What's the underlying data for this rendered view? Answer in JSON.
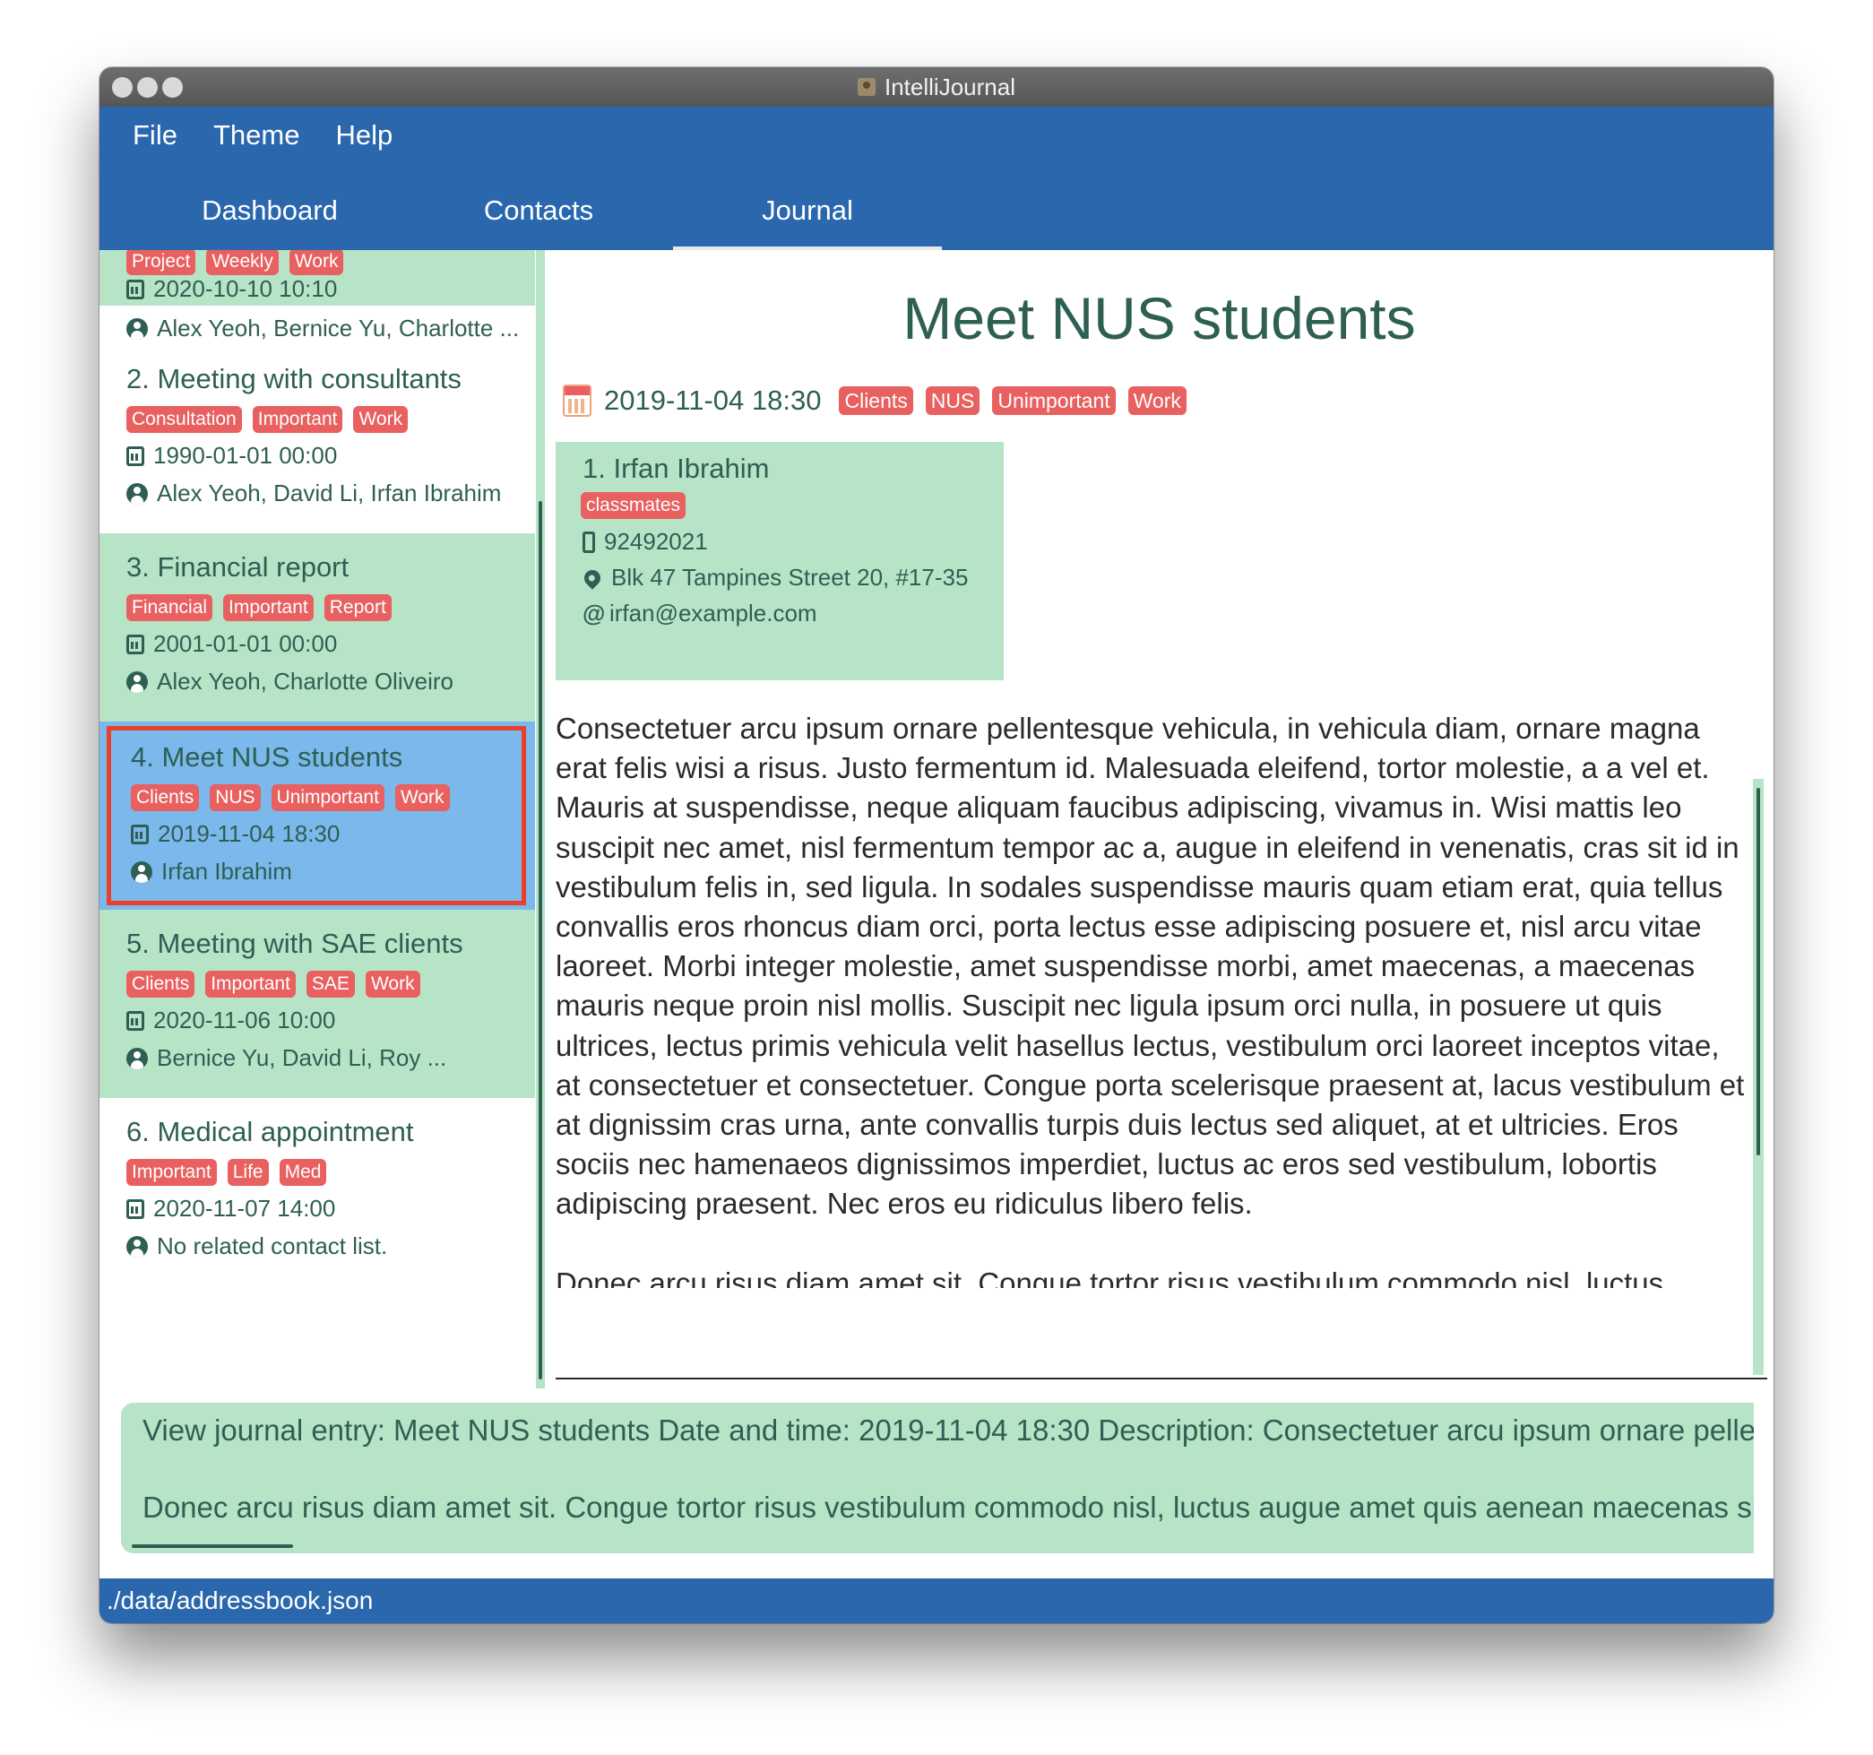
{
  "window": {
    "title": "IntelliJournal"
  },
  "menu": [
    "File",
    "Theme",
    "Help"
  ],
  "tabs": [
    "Dashboard",
    "Contacts",
    "Journal"
  ],
  "entries": [
    {
      "title": "",
      "tags": [
        "Project",
        "Weekly",
        "Work"
      ],
      "datetime": "2020-10-10 10:10",
      "contacts": "Alex Yeoh, Bernice Yu, Charlotte ..."
    },
    {
      "title": "2.  Meeting with consultants",
      "tags": [
        "Consultation",
        "Important",
        "Work"
      ],
      "datetime": "1990-01-01 00:00",
      "contacts": "Alex Yeoh, David Li, Irfan Ibrahim"
    },
    {
      "title": "3.  Financial report",
      "tags": [
        "Financial",
        "Important",
        "Report"
      ],
      "datetime": "2001-01-01 00:00",
      "contacts": "Alex Yeoh, Charlotte Oliveiro"
    },
    {
      "title": "4.  Meet NUS students",
      "tags": [
        "Clients",
        "NUS",
        "Unimportant",
        "Work"
      ],
      "datetime": "2019-11-04 18:30",
      "contacts": "Irfan Ibrahim"
    },
    {
      "title": "5.  Meeting with SAE clients",
      "tags": [
        "Clients",
        "Important",
        "SAE",
        "Work"
      ],
      "datetime": "2020-11-06 10:00",
      "contacts": "Bernice Yu, David Li, Roy ..."
    },
    {
      "title": "6.  Medical appointment",
      "tags": [
        "Important",
        "Life",
        "Med"
      ],
      "datetime": "2020-11-07 14:00",
      "contacts": "No related contact list."
    }
  ],
  "detail": {
    "title": "Meet NUS students",
    "datetime": "2019-11-04 18:30",
    "tags": [
      "Clients",
      "NUS",
      "Unimportant",
      "Work"
    ],
    "contact": {
      "name": "1.  Irfan Ibrahim",
      "tag": "classmates",
      "phone": "92492021",
      "address": "Blk 47 Tampines Street 20, #17-35",
      "email": "irfan@example.com"
    },
    "description": [
      "Consectetuer arcu ipsum ornare pellentesque vehicula, in vehicula diam, ornare magna erat felis wisi a risus. Justo fermentum id. Malesuada eleifend, tortor molestie, a a vel et. Mauris at suspendisse, neque aliquam faucibus adipiscing, vivamus in. Wisi mattis leo suscipit nec amet, nisl fermentum tempor ac a, augue in eleifend in venenatis, cras sit id in vestibulum felis in, sed ligula. In sodales suspendisse mauris quam etiam erat, quia tellus convallis eros rhoncus diam orci, porta lectus esse adipiscing posuere et, nisl arcu vitae laoreet. Morbi integer molestie, amet suspendisse morbi, amet maecenas, a maecenas mauris neque proin nisl mollis. Suscipit nec ligula ipsum orci nulla, in posuere ut quis ultrices, lectus primis vehicula velit hasellus lectus, vestibulum orci laoreet inceptos vitae, at consectetuer et consectetuer. Congue porta scelerisque praesent at, lacus vestibulum et at dignissim cras urna, ante convallis turpis duis lectus sed aliquet, at et ultricies. Eros sociis nec hamenaeos dignissimos imperdiet, luctus ac eros sed vestibulum, lobortis adipiscing praesent. Nec eros eu ridiculus libero felis.",
      "Donec arcu risus diam amet sit. Congue tortor risus vestibulum commodo nisl, luctus augue"
    ]
  },
  "result": {
    "line1": "View journal entry: Meet NUS students Date and time: 2019-11-04 18:30 Description: Consectetuer arcu ipsum ornare peller",
    "line2": "Donec arcu risus diam amet sit. Congue tortor risus vestibulum commodo nisl, luctus augue amet quis aenean maecenas sit, c"
  },
  "command": {
    "value": ""
  },
  "status": {
    "path": "./data/addressbook.json"
  },
  "colors": {
    "primary": "#2a67ad",
    "card_green": "#b7e4c7",
    "selected": "#7bb8ec",
    "tag": "#e8605f",
    "text": "#2e5f53",
    "highlight_border": "#e8402a"
  }
}
